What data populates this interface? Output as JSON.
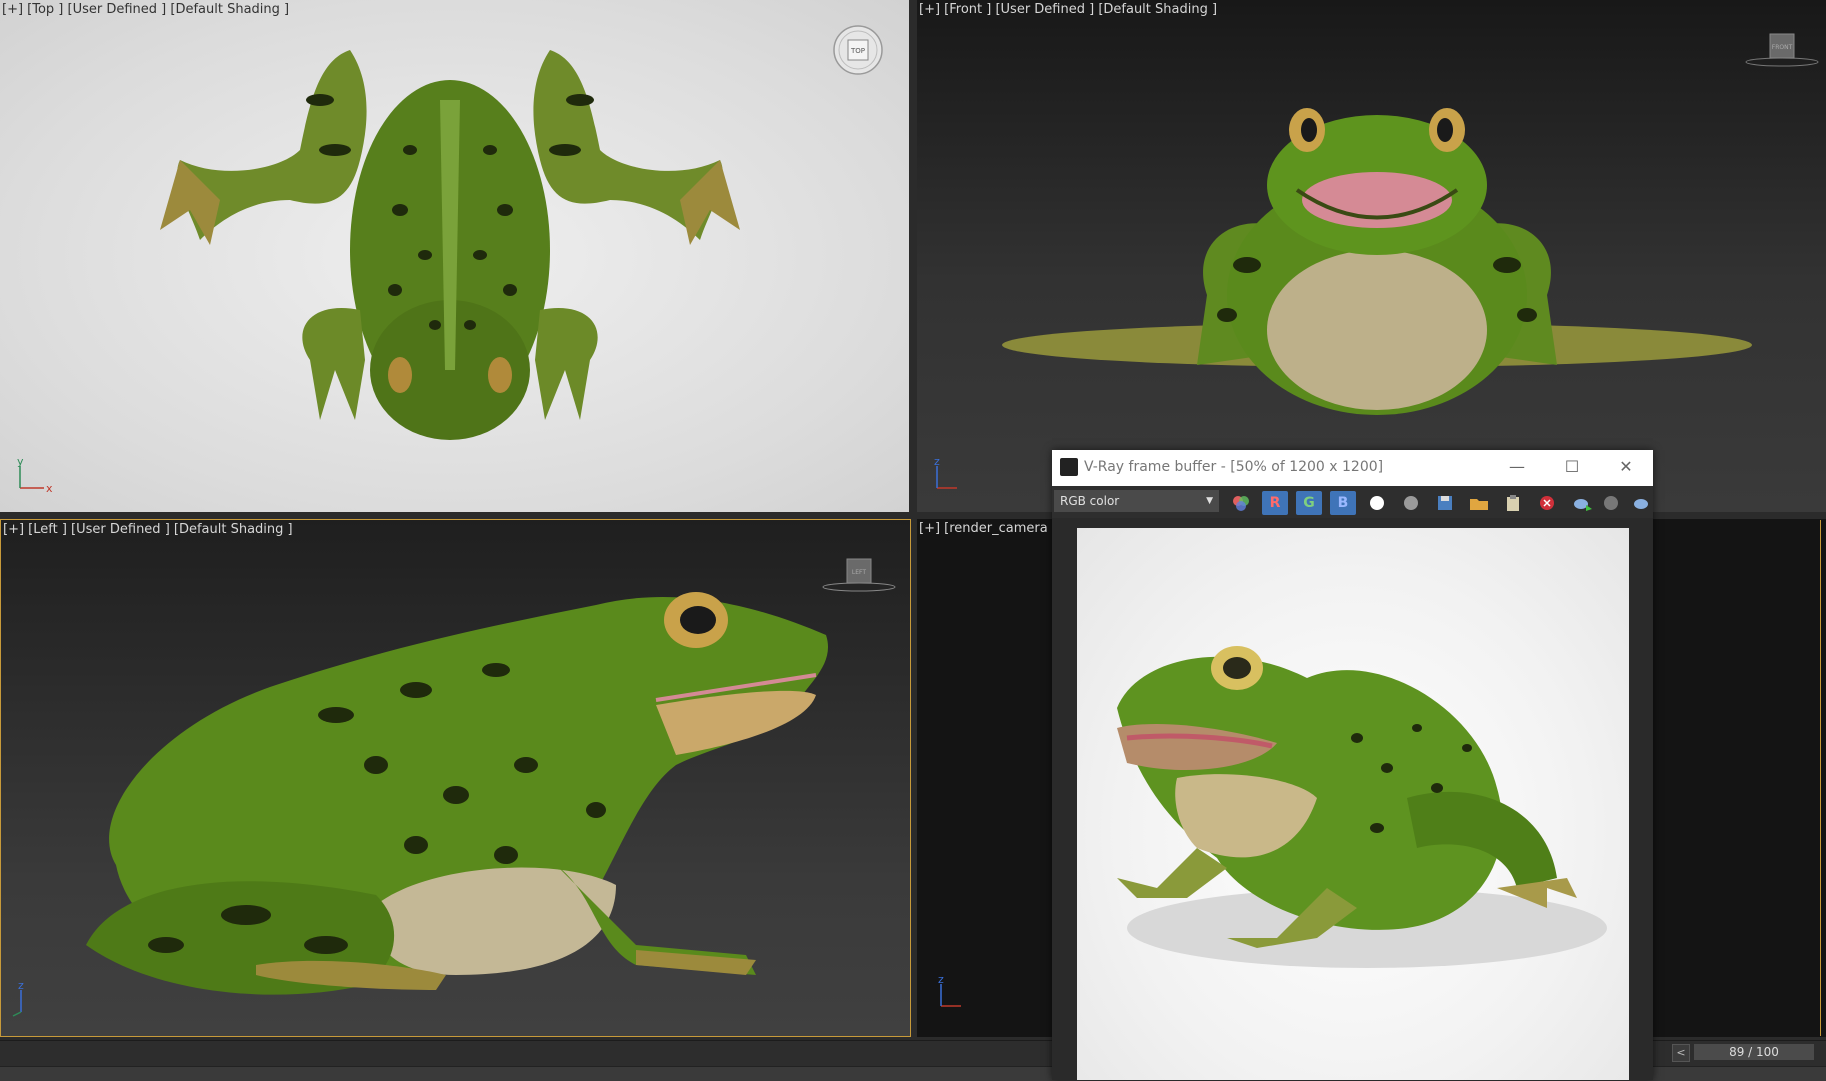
{
  "viewports": {
    "top": {
      "label": "[+] [Top ] [User Defined ] [Default Shading ]",
      "navcube": "TOP"
    },
    "front": {
      "label": "[+] [Front ] [User Defined ] [Default Shading ]",
      "navcube": "FRONT"
    },
    "left": {
      "label": "[+] [Left ] [User Defined ] [Default Shading ]",
      "navcube": "LEFT"
    },
    "camera": {
      "label": "[+] [render_camera ] ["
    }
  },
  "axes": {
    "x": "x",
    "y": "y",
    "z": "z"
  },
  "vfb": {
    "title": "V-Ray frame buffer - [50% of 1200 x 1200]",
    "channel": "RGB color",
    "buttons": {
      "r": "R",
      "g": "G",
      "b": "B"
    },
    "minimize": "—",
    "maximize": "☐",
    "close": "✕"
  },
  "timeline": {
    "frame": "89 / 100",
    "prev": "<"
  },
  "colors": {
    "accent": "#c79a3a",
    "channel_button": "#3f74b8",
    "frog_green": "#5d8a1e"
  }
}
